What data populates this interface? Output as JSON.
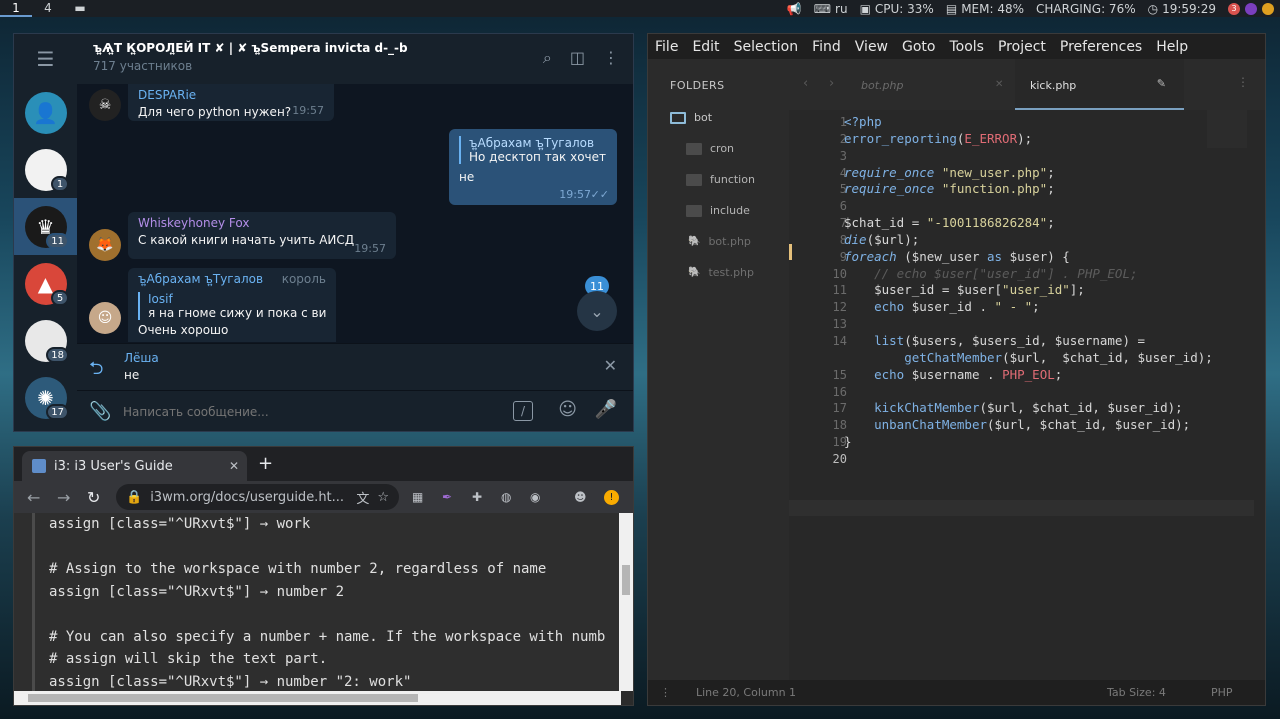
{
  "topbar": {
    "workspaces": [
      "1",
      "4"
    ],
    "active_workspace": "1",
    "kbd": "ru",
    "cpu": "CPU: 33%",
    "mem": "MEM: 48%",
    "battery": "CHARGING: 76%",
    "clock": "19:59:29",
    "tray_badge": "3"
  },
  "telegram": {
    "chat_title": "ъ͍Ѧ͍Т К͍ОРОЛ͍ЕЙ ΙΤ ✘ | ✘ ъ͍Sempera invicta d-_-b",
    "members": "717 участников",
    "chats": [
      {
        "badge": "",
        "icon": "person-icon"
      },
      {
        "badge": "1",
        "icon": "apple-icon"
      },
      {
        "badge": "11",
        "icon": "lion-icon"
      },
      {
        "badge": "5",
        "icon": "arch-icon"
      },
      {
        "badge": "18",
        "icon": "apple-icon"
      },
      {
        "badge": "17",
        "icon": "art-icon"
      }
    ],
    "messages": [
      {
        "name": "DESPARie",
        "text": "Для чего python нужен?",
        "time": "19:57"
      },
      {
        "reply_name": "ъ͍Абрахам ъ͍Тугалов",
        "reply_text": "Но десктоп так хочет...",
        "text": "не",
        "time": "19:57"
      },
      {
        "name": "Whiskeyhoney Fox",
        "text": "С какой книги начать учить АИСД",
        "time": "19:57"
      },
      {
        "name": "ъ͍Абрахам ъ͍Тугалов",
        "role": "король",
        "reply_name": "Iosif",
        "reply_text": "я на гноме сижу и пока с ви...",
        "text": "Очень хорошо"
      }
    ],
    "unread": "11",
    "reply_to": {
      "name": "Лёша",
      "text": "не"
    },
    "input_placeholder": "Написать сообщение..."
  },
  "chrome": {
    "tab_title": "i3: i3 User's Guide",
    "url": "i3wm.org/docs/userguide.ht...",
    "code_lines": [
      "assign [class=\"^URxvt$\"] → work",
      "",
      "# Assign to the workspace with number 2, regardless of name",
      "assign [class=\"^URxvt$\"] → number 2",
      "",
      "# You can also specify a number + name. If the workspace with numb",
      "# assign will skip the text part.",
      "assign [class=\"^URxvt$\"] → number \"2: work\""
    ]
  },
  "sublime": {
    "menu": [
      "File",
      "Edit",
      "Selection",
      "Find",
      "View",
      "Goto",
      "Tools",
      "Project",
      "Preferences",
      "Help"
    ],
    "folders_label": "FOLDERS",
    "tree": [
      {
        "name": "bot",
        "type": "folder-open"
      },
      {
        "name": "cron",
        "type": "folder"
      },
      {
        "name": "function",
        "type": "folder"
      },
      {
        "name": "include",
        "type": "folder"
      },
      {
        "name": "bot.php",
        "type": "file"
      },
      {
        "name": "test.php",
        "type": "file"
      }
    ],
    "tabs": [
      {
        "name": "bot.php",
        "active": false
      },
      {
        "name": "kick.php",
        "active": true
      }
    ],
    "line_numbers": [
      "1",
      "2",
      "3",
      "4",
      "5",
      "6",
      "7",
      "8",
      "9",
      "10",
      "11",
      "12",
      "13",
      "14",
      "",
      "15",
      "16",
      "17",
      "18",
      "19",
      "20"
    ],
    "status_left": "Line 20, Column 1",
    "status_tab": "Tab Size: 4",
    "status_syntax": "PHP"
  }
}
